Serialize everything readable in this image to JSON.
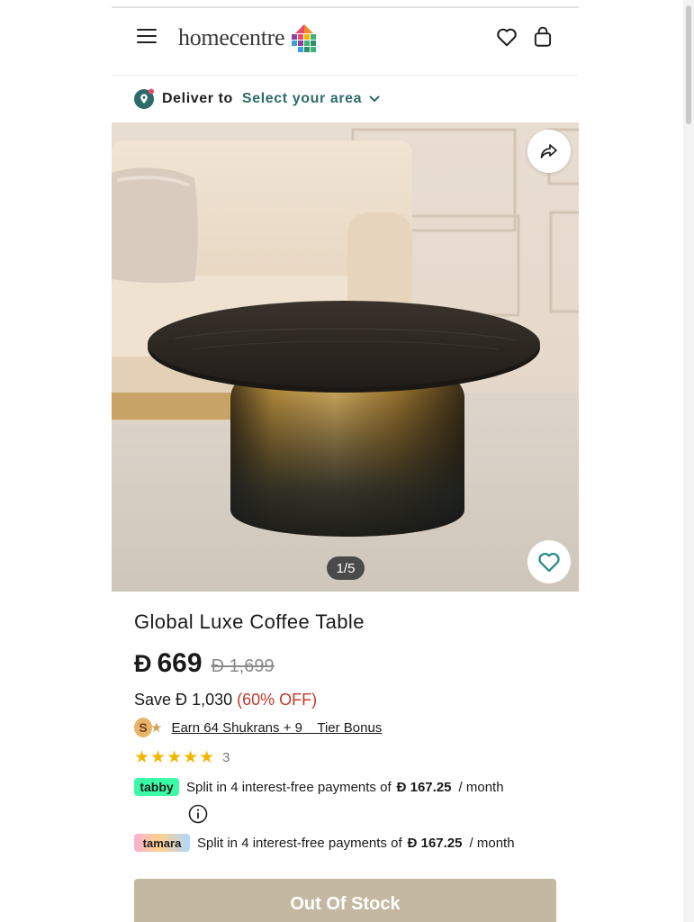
{
  "header": {
    "logo_text": "homecentre",
    "menu_icon": "hamburger-menu-icon",
    "wishlist_icon": "heart-icon",
    "bag_icon": "shopping-bag-icon"
  },
  "delivery": {
    "label": "Deliver to",
    "value": "Select your area"
  },
  "gallery": {
    "counter": "1/5"
  },
  "product": {
    "title": "Global Luxe Coffee Table",
    "currency": "Đ",
    "price": "669",
    "old_price": "1,699",
    "save_label": "Save",
    "save_amount": "1,030",
    "discount": "(60% OFF)",
    "shukrans_badge": "S",
    "shukrans_text": "Earn 64 Shukrans + 9    Tier Bonus",
    "rating_value": 5,
    "rating_stars": "★★★★★",
    "rating_count": "3"
  },
  "payments": {
    "tabby": {
      "logo": "tabby",
      "text": "Split in 4 interest-free payments of",
      "amount": "167.25",
      "suffix": "/ month"
    },
    "tamara": {
      "logo": "tamara",
      "text": "Split in 4 interest-free payments of",
      "amount": "167.25",
      "suffix": "/ month"
    }
  },
  "cta": {
    "label": "Out Of Stock"
  },
  "colors": {
    "accent_teal": "#2d6b6b",
    "discount_red": "#c0392b",
    "star_gold": "#f2b600",
    "oos_button": "#c5b8a2"
  }
}
